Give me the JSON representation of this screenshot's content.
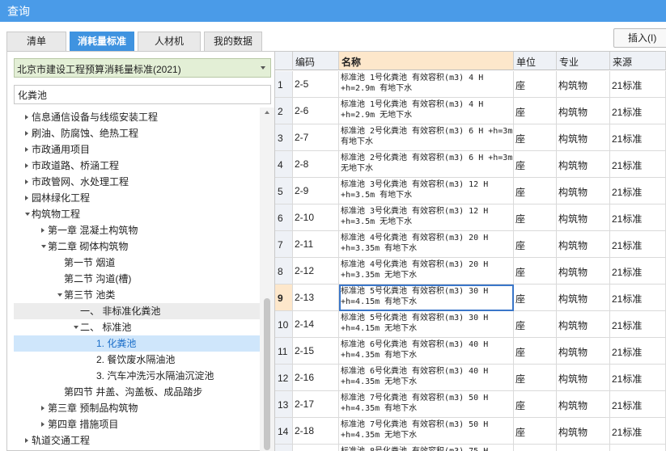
{
  "window": {
    "title": "查询"
  },
  "tabs": [
    {
      "label": "清单",
      "active": false
    },
    {
      "label": "消耗量标准",
      "active": true
    },
    {
      "label": "人材机",
      "active": false
    },
    {
      "label": "我的数据",
      "active": false
    }
  ],
  "insert_button": "插入(I)",
  "standard_select": {
    "value": "北京市建设工程预算消耗量标准(2021)"
  },
  "search": {
    "value": "化粪池",
    "placeholder": ""
  },
  "tree": [
    {
      "label": "信息通信设备与线缆安装工程",
      "level": 0,
      "expander": "collapsed",
      "state": ""
    },
    {
      "label": "刷油、防腐蚀、绝热工程",
      "level": 0,
      "expander": "collapsed",
      "state": ""
    },
    {
      "label": "市政通用项目",
      "level": 0,
      "expander": "collapsed",
      "state": ""
    },
    {
      "label": "市政道路、桥涵工程",
      "level": 0,
      "expander": "collapsed",
      "state": ""
    },
    {
      "label": "市政管网、水处理工程",
      "level": 0,
      "expander": "collapsed",
      "state": ""
    },
    {
      "label": "园林绿化工程",
      "level": 0,
      "expander": "collapsed",
      "state": ""
    },
    {
      "label": "构筑物工程",
      "level": 0,
      "expander": "expanded",
      "state": ""
    },
    {
      "label": "第一章 混凝土构筑物",
      "level": 1,
      "expander": "collapsed",
      "state": ""
    },
    {
      "label": "第二章 砌体构筑物",
      "level": 1,
      "expander": "expanded",
      "state": ""
    },
    {
      "label": "第一节 烟道",
      "level": 2,
      "expander": "none",
      "state": ""
    },
    {
      "label": "第二节 沟道(槽)",
      "level": 2,
      "expander": "none",
      "state": ""
    },
    {
      "label": "第三节 池类",
      "level": 2,
      "expander": "expanded",
      "state": ""
    },
    {
      "label": "一、 非标准化粪池",
      "level": 3,
      "expander": "none",
      "state": "gray"
    },
    {
      "label": "二、 标准池",
      "level": 3,
      "expander": "expanded",
      "state": ""
    },
    {
      "label": "1. 化粪池",
      "level": 4,
      "expander": "none",
      "state": "selected"
    },
    {
      "label": "2. 餐饮废水隔油池",
      "level": 4,
      "expander": "none",
      "state": ""
    },
    {
      "label": "3. 汽车冲洗污水隔油沉淀池",
      "level": 4,
      "expander": "none",
      "state": ""
    },
    {
      "label": "第四节 井盖、沟盖板、成品踏步",
      "level": 2,
      "expander": "none",
      "state": ""
    },
    {
      "label": "第三章 预制品构筑物",
      "level": 1,
      "expander": "collapsed",
      "state": ""
    },
    {
      "label": "第四章 措施项目",
      "level": 1,
      "expander": "collapsed",
      "state": ""
    },
    {
      "label": "轨道交通工程",
      "level": 0,
      "expander": "collapsed",
      "state": ""
    }
  ],
  "table": {
    "columns": [
      "",
      "编码",
      "名称",
      "单位",
      "专业",
      "来源"
    ],
    "current_row": 9,
    "rows": [
      {
        "n": "1",
        "code": "2-5",
        "name": "标准池 1号化粪池 有效容积(m3) 4 H +h=2.9m 有地下水",
        "unit": "座",
        "prof": "构筑物",
        "src": "21标准"
      },
      {
        "n": "2",
        "code": "2-6",
        "name": "标准池 1号化粪池 有效容积(m3) 4 H +h=2.9m 无地下水",
        "unit": "座",
        "prof": "构筑物",
        "src": "21标准"
      },
      {
        "n": "3",
        "code": "2-7",
        "name": "标准池 2号化粪池 有效容积(m3) 6 H +h=3m 有地下水",
        "unit": "座",
        "prof": "构筑物",
        "src": "21标准"
      },
      {
        "n": "4",
        "code": "2-8",
        "name": "标准池 2号化粪池 有效容积(m3) 6 H +h=3m 无地下水",
        "unit": "座",
        "prof": "构筑物",
        "src": "21标准"
      },
      {
        "n": "5",
        "code": "2-9",
        "name": "标准池 3号化粪池 有效容积(m3) 12 H +h=3.5m 有地下水",
        "unit": "座",
        "prof": "构筑物",
        "src": "21标准"
      },
      {
        "n": "6",
        "code": "2-10",
        "name": "标准池 3号化粪池 有效容积(m3) 12 H +h=3.5m 无地下水",
        "unit": "座",
        "prof": "构筑物",
        "src": "21标准"
      },
      {
        "n": "7",
        "code": "2-11",
        "name": "标准池 4号化粪池 有效容积(m3) 20 H +h=3.35m 有地下水",
        "unit": "座",
        "prof": "构筑物",
        "src": "21标准"
      },
      {
        "n": "8",
        "code": "2-12",
        "name": "标准池 4号化粪池 有效容积(m3) 20 H +h=3.35m 无地下水",
        "unit": "座",
        "prof": "构筑物",
        "src": "21标准"
      },
      {
        "n": "9",
        "code": "2-13",
        "name": "标准池 5号化粪池 有效容积(m3) 30 H +h=4.15m 有地下水",
        "unit": "座",
        "prof": "构筑物",
        "src": "21标准"
      },
      {
        "n": "10",
        "code": "2-14",
        "name": "标准池 5号化粪池 有效容积(m3) 30 H +h=4.15m 无地下水",
        "unit": "座",
        "prof": "构筑物",
        "src": "21标准"
      },
      {
        "n": "11",
        "code": "2-15",
        "name": "标准池 6号化粪池 有效容积(m3) 40 H +h=4.35m 有地下水",
        "unit": "座",
        "prof": "构筑物",
        "src": "21标准"
      },
      {
        "n": "12",
        "code": "2-16",
        "name": "标准池 6号化粪池 有效容积(m3) 40 H +h=4.35m 无地下水",
        "unit": "座",
        "prof": "构筑物",
        "src": "21标准"
      },
      {
        "n": "13",
        "code": "2-17",
        "name": "标准池 7号化粪池 有效容积(m3) 50 H +h=4.35m 有地下水",
        "unit": "座",
        "prof": "构筑物",
        "src": "21标准"
      },
      {
        "n": "14",
        "code": "2-18",
        "name": "标准池 7号化粪池 有效容积(m3) 50 H +h=4.35m 无地下水",
        "unit": "座",
        "prof": "构筑物",
        "src": "21标准"
      },
      {
        "n": "",
        "code": "",
        "name": "标准池 8号化粪池 有效容积(m3) 75 H",
        "unit": "",
        "prof": "",
        "src": ""
      }
    ]
  },
  "colors": {
    "accent": "#4a9be8",
    "active_tab": "#3f93e0",
    "name_header": "#fde7cb",
    "select_bg": "#e3efd6",
    "tree_selected": "#cfe6fb"
  }
}
